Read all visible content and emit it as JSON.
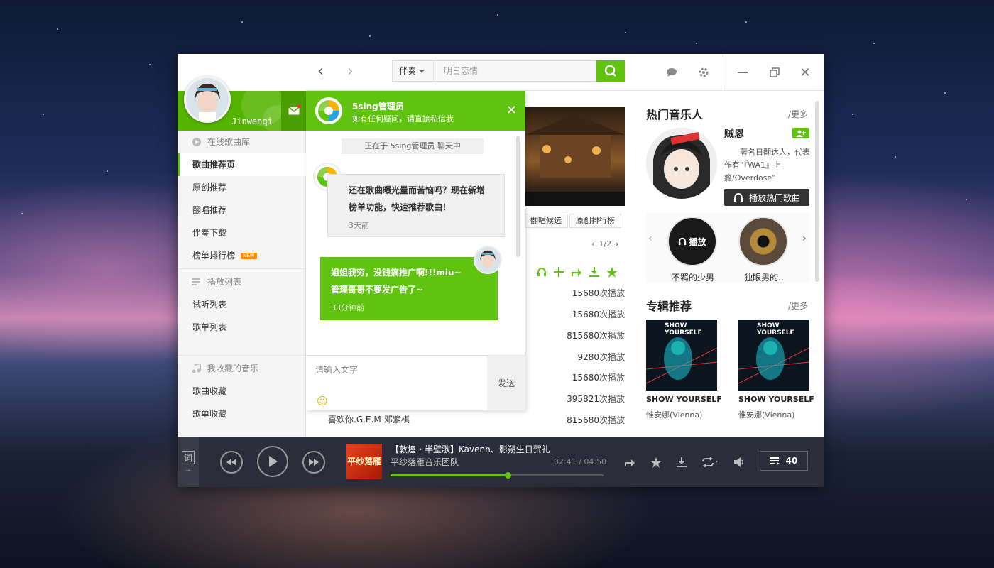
{
  "user": {
    "name": "Jinwenqi"
  },
  "search": {
    "type": "伴奏",
    "placeholder": "明日恋情"
  },
  "sidebar": {
    "sections": [
      {
        "label": "在线歌曲库",
        "items": [
          {
            "label": "歌曲推荐页",
            "active": true
          },
          {
            "label": "原创推荐"
          },
          {
            "label": "翻唱推荐"
          },
          {
            "label": "伴奏下载"
          },
          {
            "label": "榜单排行榜",
            "badge": "NEW"
          }
        ]
      },
      {
        "label": "播放列表",
        "items": [
          {
            "label": "试听列表"
          },
          {
            "label": "歌单列表"
          }
        ]
      },
      {
        "label": "我收藏的音乐",
        "items": [
          {
            "label": "歌曲收藏"
          },
          {
            "label": "歌单收藏"
          }
        ]
      }
    ]
  },
  "chat": {
    "title": "5sing管理员",
    "subtitle": "如有任何疑问，请直接私信我",
    "status": "正在于 5sing管理员 聊天中",
    "messages": [
      {
        "text1": "还在歌曲曝光量而苦恼吗？现在新增",
        "text2": "榜单功能，快速推荐歌曲！",
        "time": "3天前"
      },
      {
        "text1": "姐姐我穷，没钱搞推广啊!!!miu~",
        "text2": "管理哥哥不要发广告了~",
        "time": "33分钟前"
      }
    ],
    "input_placeholder": "请输入文字",
    "send_label": "发送"
  },
  "main": {
    "tags": [
      "翻唱候选",
      "原创排行榜"
    ],
    "pager": "1/2",
    "plays_suffix": "次播放",
    "plays": [
      "15680",
      "15680",
      "815680",
      "9280",
      "15680",
      "395821",
      "815680"
    ],
    "last_song": "喜欢你.G.E.M-邓紫棋"
  },
  "right": {
    "hot_title": "热门音乐人",
    "more": "/更多",
    "artist_name": "贼恩",
    "artist_desc": "著名日翻达人，代表作有“『WA1』上瘾/Overdose”",
    "hot_btn": "播放热门歌曲",
    "minis": [
      {
        "label": "不羁的少男",
        "overlay": "播放"
      },
      {
        "label": "独眼男的.."
      }
    ],
    "album_title": "专辑推荐",
    "albums": [
      {
        "title": "SHOW YOURSELF",
        "artist": "惟安娜(Vienna)"
      },
      {
        "title": "SHOW YOURSELF",
        "artist": "惟安娜(Vienna)"
      }
    ],
    "album_cover_text": "SHOW YOURSELF"
  },
  "player": {
    "lyric": "词",
    "track_title": "【敦煌・半壁歌】Kavenn、影朔生日贺礼",
    "track_artist": "平纱落雁音乐团队",
    "time": "02:41 / 04:50",
    "progress": 0.55,
    "cover_text": "平纱落雁",
    "playlist_count": "40"
  },
  "colors": {
    "accent": "#5fc310",
    "player_bg": "#2c2d3b"
  }
}
